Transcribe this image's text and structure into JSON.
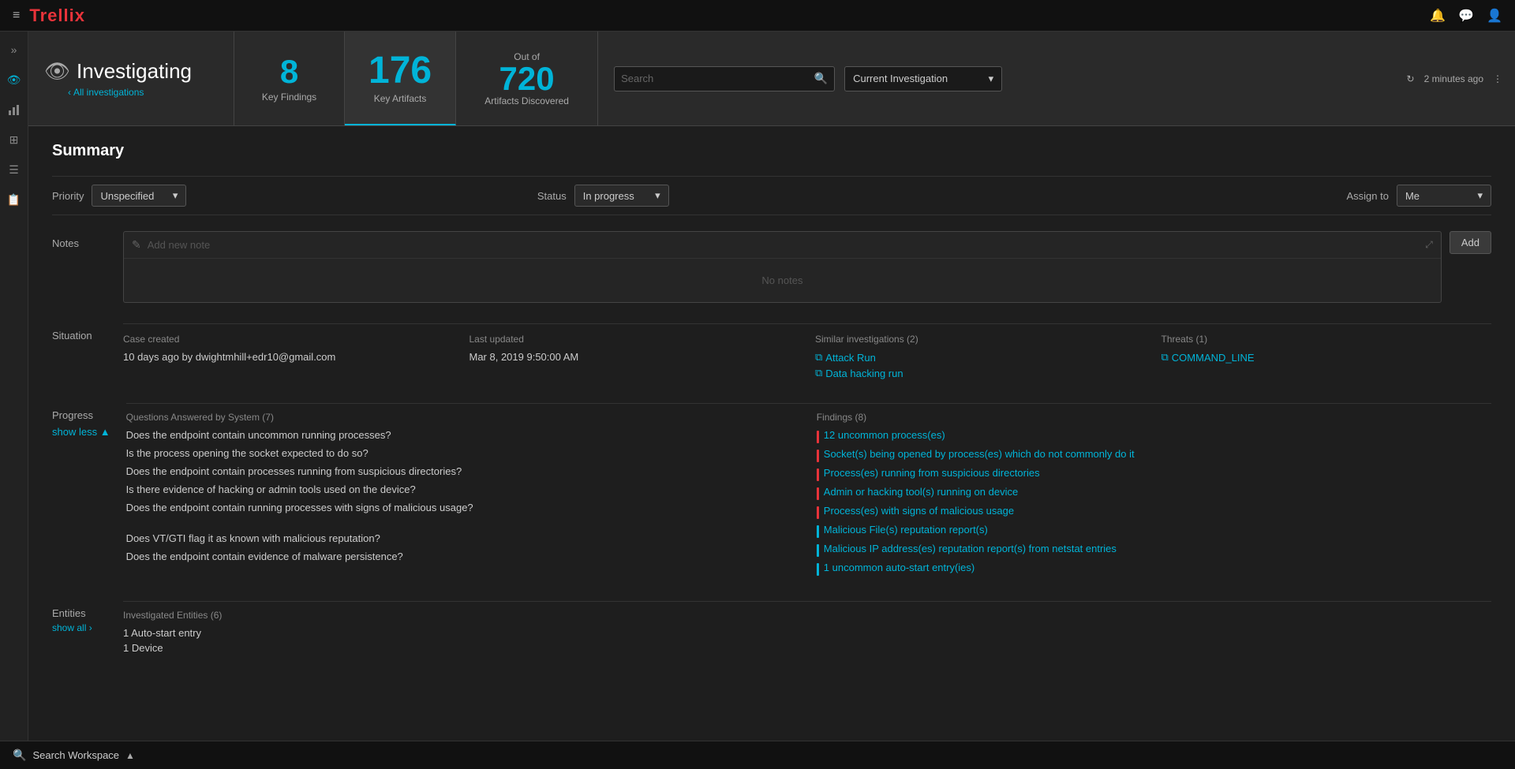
{
  "app": {
    "name": "Trellix"
  },
  "topnav": {
    "hamburger": "≡",
    "logo": "Trellix",
    "icons": [
      "🔔",
      "💬",
      "👤"
    ]
  },
  "header": {
    "eye_icon": "👁",
    "investigating_label": "Investigating",
    "all_investigations_link": "All investigations",
    "stats": {
      "key_findings_number": "8",
      "key_findings_label": "Key Findings",
      "key_artifacts_number": "176",
      "key_artifacts_label": "Key Artifacts",
      "out_of_label": "Out of",
      "artifacts_discovered_number": "720",
      "artifacts_discovered_label": "Artifacts Discovered"
    },
    "search_placeholder": "Search",
    "filter": {
      "label": "Current Investigation",
      "chevron": "▾"
    },
    "refresh_label": "2 minutes ago",
    "refresh_icon": "↻",
    "more_icon": "⋮"
  },
  "sidebar": {
    "icons": [
      {
        "name": "expand-icon",
        "glyph": "»"
      },
      {
        "name": "eye-nav-icon",
        "glyph": "👁"
      },
      {
        "name": "chart-nav-icon",
        "glyph": "📈"
      },
      {
        "name": "grid-nav-icon",
        "glyph": "⊞"
      },
      {
        "name": "table-nav-icon",
        "glyph": "☰"
      },
      {
        "name": "book-nav-icon",
        "glyph": "📋"
      }
    ]
  },
  "page": {
    "title": "Summary",
    "priority": {
      "label": "Priority",
      "value": "Unspecified",
      "chevron": "▾"
    },
    "status": {
      "label": "Status",
      "value": "In progress",
      "chevron": "▾"
    },
    "assign_to": {
      "label": "Assign to",
      "value": "Me",
      "chevron": "▾"
    },
    "notes": {
      "label": "Notes",
      "placeholder": "Add new note",
      "add_button": "Add",
      "empty_message": "No notes"
    },
    "situation": {
      "label": "Situation",
      "case_created_header": "Case created",
      "case_created_value": "10 days ago by dwightmhill+edr10@gmail.com",
      "last_updated_header": "Last updated",
      "last_updated_value": "Mar 8, 2019 9:50:00 AM",
      "similar_investigations_header": "Similar investigations (2)",
      "similar_links": [
        {
          "label": "Attack Run",
          "icon": "⧉"
        },
        {
          "label": "Data hacking run",
          "icon": "⧉"
        }
      ],
      "threats_header": "Threats (1)",
      "threat_links": [
        {
          "label": "COMMAND_LINE",
          "icon": "⧉"
        }
      ]
    },
    "progress": {
      "title_label": "Progress",
      "show_less_label": "show less ▲",
      "questions_header": "Questions Answered by System (7)",
      "findings_header": "Findings (8)",
      "questions": [
        "Does the endpoint contain uncommon running processes?",
        "Is the process opening the socket expected to do so?",
        "Does the endpoint contain processes running from suspicious directories?",
        "Is there evidence of hacking or admin tools used on the device?",
        "Does the endpoint contain running processes with signs of malicious usage?",
        "",
        "Does VT/GTI flag it as known with malicious reputation?",
        "Does the endpoint contain evidence of malware persistence?"
      ],
      "findings": [
        {
          "text": "12 uncommon process(es)",
          "color": "red"
        },
        {
          "text": "Socket(s) being opened by process(es) which do not commonly do it",
          "color": "red"
        },
        {
          "text": "Process(es) running from suspicious directories",
          "color": "red"
        },
        {
          "text": "Admin or hacking tool(s) running on device",
          "color": "red"
        },
        {
          "text": "Process(es) with signs of malicious usage",
          "color": "red"
        },
        {
          "text": "Malicious File(s) reputation report(s)",
          "color": "blue"
        },
        {
          "text": "Malicious IP address(es) reputation report(s) from netstat entries",
          "color": "blue"
        },
        {
          "text": "1 uncommon auto-start entry(ies)",
          "color": "blue"
        }
      ]
    },
    "entities": {
      "title_label": "Entities",
      "show_all_label": "show all ›",
      "investigated_header": "Investigated Entities (6)",
      "entity_items": [
        "1 Auto-start entry",
        "1 Device"
      ]
    }
  },
  "bottom_bar": {
    "label": "Search Workspace",
    "chevron": "▲"
  }
}
